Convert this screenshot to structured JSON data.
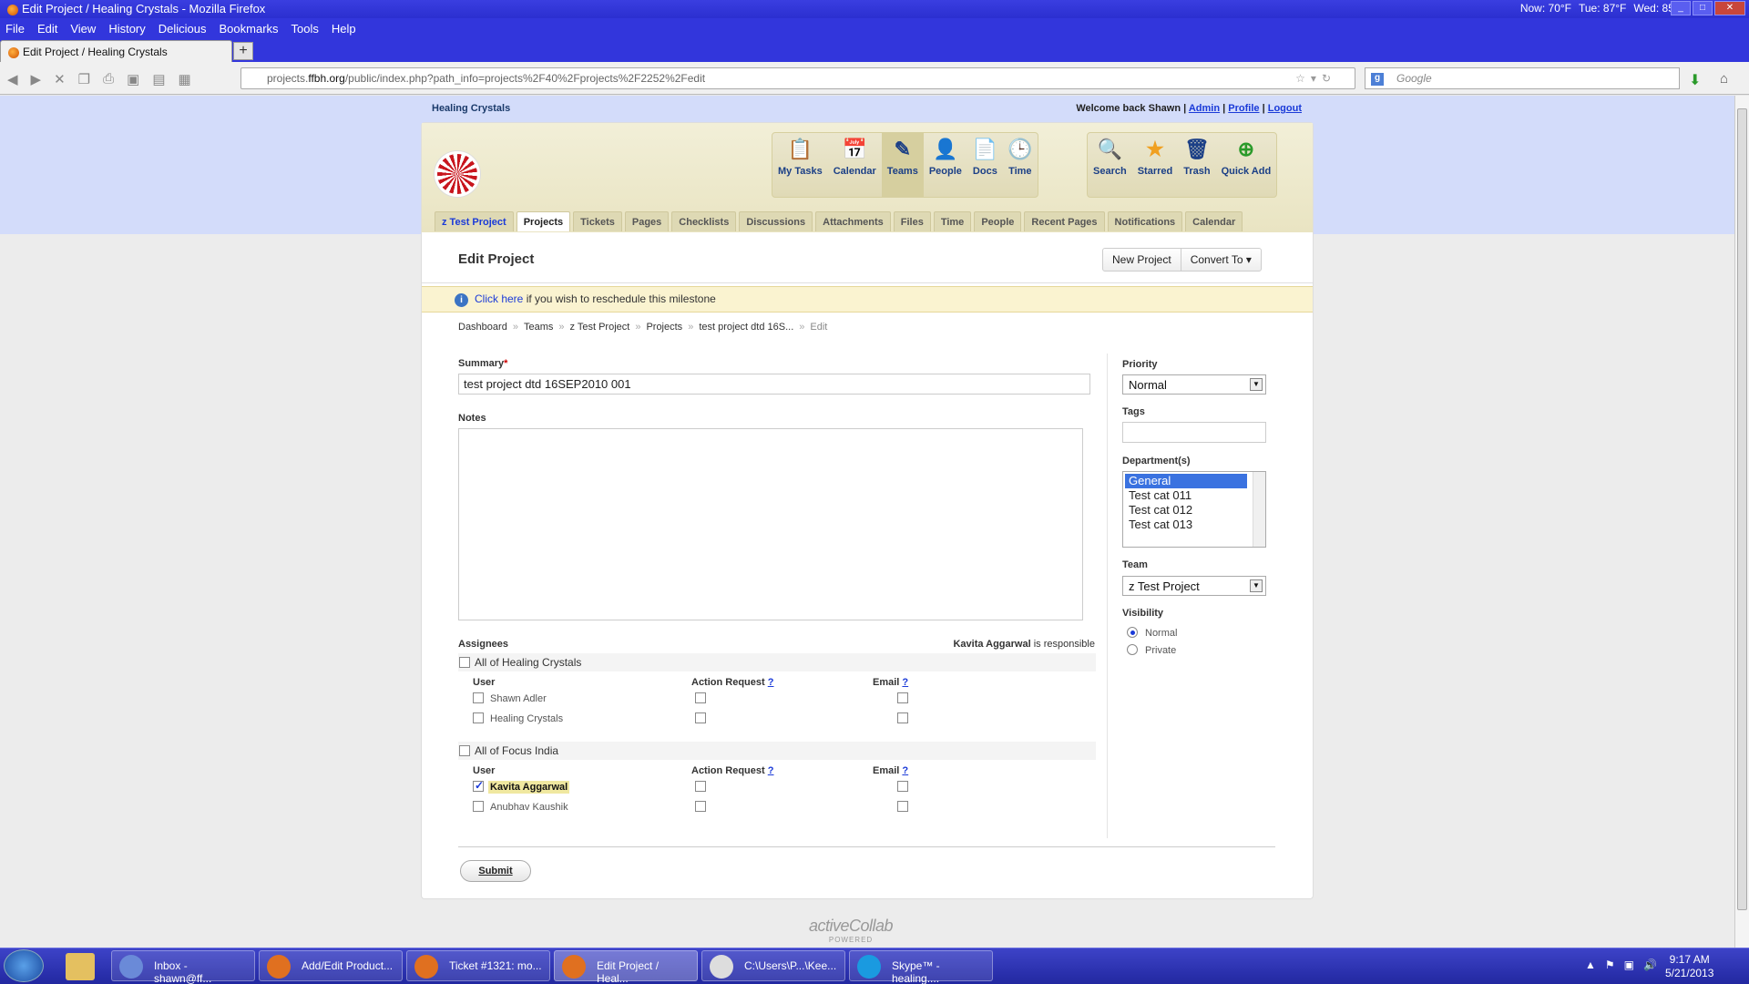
{
  "window": {
    "title": "Edit Project / Healing Crystals - Mozilla Firefox",
    "weather_now": "Now: 70°F",
    "weather_tue": "Tue: 87°F",
    "weather_wed": "Wed: 85°F"
  },
  "menu": [
    "File",
    "Edit",
    "View",
    "History",
    "Delicious",
    "Bookmarks",
    "Tools",
    "Help"
  ],
  "browser_tab": {
    "label": "Edit Project / Healing Crystals",
    "new_tab": "+"
  },
  "address": {
    "host": "projects.",
    "domain": "ffbh.org",
    "path": "/public/index.php?path_info=projects%2F40%2Fprojects%2F2252%2Fedit"
  },
  "search": {
    "placeholder": "Google"
  },
  "site": {
    "name": "Healing Crystals",
    "welcome": "Welcome back Shawn",
    "links": [
      "Admin",
      "Profile",
      "Logout"
    ]
  },
  "toolbar": {
    "group1": [
      {
        "label": "My Tasks",
        "icon": "my-tasks-icon"
      },
      {
        "label": "Calendar",
        "icon": "calendar-icon"
      },
      {
        "label": "Teams",
        "icon": "teams-icon"
      },
      {
        "label": "People",
        "icon": "people-icon"
      },
      {
        "label": "Docs",
        "icon": "docs-icon"
      },
      {
        "label": "Time",
        "icon": "time-icon"
      }
    ],
    "group2": [
      {
        "label": "Search",
        "icon": "search-icon"
      },
      {
        "label": "Starred",
        "icon": "star-icon"
      },
      {
        "label": "Trash",
        "icon": "trash-icon"
      },
      {
        "label": "Quick Add",
        "icon": "quick-add-icon"
      }
    ]
  },
  "tabs": [
    "z Test Project",
    "Projects",
    "Tickets",
    "Pages",
    "Checklists",
    "Discussions",
    "Attachments",
    "Files",
    "Time",
    "People",
    "Recent Pages",
    "Notifications",
    "Calendar"
  ],
  "active_tab": "Projects",
  "page": {
    "title": "Edit Project",
    "new_project": "New Project",
    "convert_to": "Convert To",
    "notice_link": "Click here",
    "notice_text": " if you wish to reschedule this milestone"
  },
  "breadcrumb": [
    "Dashboard",
    "Teams",
    "z Test Project",
    "Projects",
    "test project dtd 16S...",
    "Edit"
  ],
  "form": {
    "summary_label": "Summary",
    "summary_value": "test project dtd 16SEP2010 001",
    "notes_label": "Notes",
    "notes_value": "",
    "assignees_label": "Assignees",
    "responsible_name": "Kavita Aggarwal",
    "responsible_suffix": " is responsible",
    "companies": [
      {
        "name": "All of Healing Crystals",
        "users": [
          {
            "name": "Shawn Adler",
            "checked": false
          },
          {
            "name": "Healing Crystals",
            "checked": false
          }
        ]
      },
      {
        "name": "All of Focus India",
        "users": [
          {
            "name": "Kavita Aggarwal",
            "checked": true
          },
          {
            "name": "Anubhav Kaushik",
            "checked": false
          }
        ]
      }
    ],
    "col_user": "User",
    "col_action": "Action Request",
    "col_email": "Email",
    "q": "?",
    "priority_label": "Priority",
    "priority_value": "Normal",
    "tags_label": "Tags",
    "tags_value": "",
    "departments_label": "Department(s)",
    "departments": [
      "General",
      "Test cat 011",
      "Test cat 012",
      "Test cat 013"
    ],
    "team_label": "Team",
    "team_value": "z Test Project",
    "visibility_label": "Visibility",
    "visibility_options": [
      "Normal",
      "Private"
    ],
    "submit": "Submit"
  },
  "footer": {
    "brand": "activeCollab",
    "sub": "POWERED"
  },
  "taskbar": {
    "items": [
      "Inbox - shawn@ff...",
      "Add/Edit Product...",
      "Ticket #1321: mo...",
      "Edit Project / Heal...",
      "C:\\Users\\P...\\Kee...",
      "Skype™ - healing...."
    ],
    "time": "9:17 AM",
    "date": "5/21/2013"
  }
}
